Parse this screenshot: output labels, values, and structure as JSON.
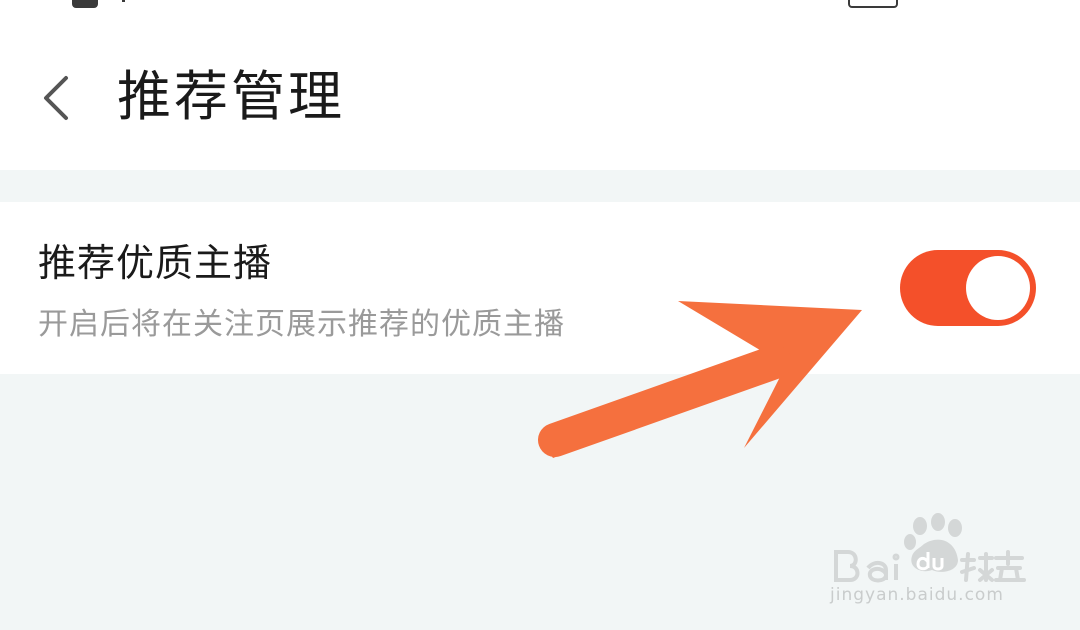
{
  "header": {
    "title": "推荐管理",
    "back_icon": "chevron-left-icon"
  },
  "setting": {
    "title": "推荐优质主播",
    "description": "开启后将在关注页展示推荐的优质主播",
    "toggle_on": true
  },
  "colors": {
    "accent": "#f4502a",
    "arrow": "#f5703e",
    "background": "#f2f6f6"
  },
  "watermark": {
    "brand": "Bai du 经验",
    "url": "jingyan.baidu.com"
  }
}
